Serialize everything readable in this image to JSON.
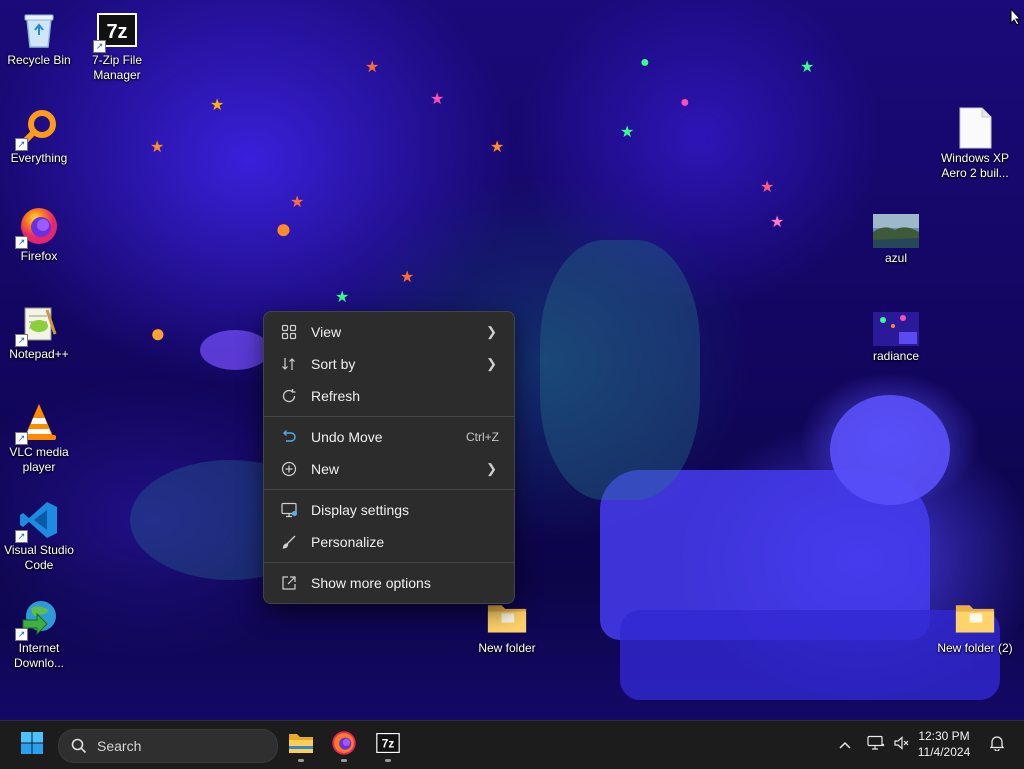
{
  "desktop": {
    "icons_left": [
      {
        "label": "Recycle Bin"
      },
      {
        "label": "7-Zip File Manager"
      },
      {
        "label": "Everything"
      },
      {
        "label": "Firefox"
      },
      {
        "label": "Notepad++"
      },
      {
        "label": "VLC media player"
      },
      {
        "label": "Visual Studio Code"
      },
      {
        "label": "Internet Downlo..."
      }
    ],
    "icons_right": [
      {
        "label": "Windows XP Aero 2 buil..."
      },
      {
        "label": "azul"
      },
      {
        "label": "radiance"
      },
      {
        "label": "New folder (2)"
      }
    ],
    "icons_middle": [
      {
        "label": "New folder"
      }
    ]
  },
  "context_menu": {
    "items": [
      {
        "label": "View",
        "icon": "grid-icon",
        "has_submenu": true
      },
      {
        "label": "Sort by",
        "icon": "sort-icon",
        "has_submenu": true
      },
      {
        "label": "Refresh",
        "icon": "refresh-icon"
      },
      {
        "label": "Undo Move",
        "icon": "undo-icon",
        "shortcut": "Ctrl+Z"
      },
      {
        "label": "New",
        "icon": "plus-circle-icon",
        "has_submenu": true
      },
      {
        "label": "Display settings",
        "icon": "display-icon"
      },
      {
        "label": "Personalize",
        "icon": "brush-icon"
      },
      {
        "label": "Show more options",
        "icon": "share-icon"
      }
    ]
  },
  "taskbar": {
    "search_placeholder": "Search",
    "pinned": [
      "file-explorer-icon",
      "firefox-icon",
      "7zip-icon"
    ],
    "clock": {
      "time": "12:30 PM",
      "date": "11/4/2024"
    }
  },
  "colors": {
    "menu_bg": "#2c2c2c",
    "taskbar_bg": "#1c1c1c",
    "accent_blue": "#0078d4"
  }
}
